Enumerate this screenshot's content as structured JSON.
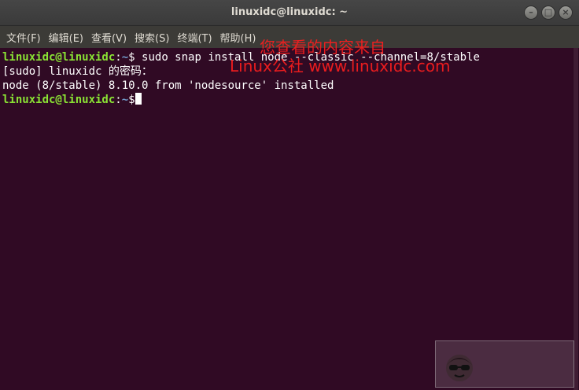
{
  "window": {
    "title": "linuxidc@linuxidc: ~",
    "controls": [
      "–",
      "□",
      "×"
    ]
  },
  "menubar": {
    "items": [
      "文件(F)",
      "编辑(E)",
      "查看(V)",
      "搜索(S)",
      "终端(T)",
      "帮助(H)"
    ]
  },
  "terminal": {
    "lines": [
      {
        "user": "linuxidc@linuxidc",
        "sep": ":",
        "path": "~",
        "prompt": "$ ",
        "text": "sudo snap install node --classic --channel=8/stable"
      },
      {
        "text": "[sudo] linuxidc 的密码："
      },
      {
        "text": "node (8/stable) 8.10.0 from 'nodesource' installed"
      },
      {
        "user": "linuxidc@linuxidc",
        "sep": ":",
        "path": "~",
        "prompt": "$",
        "text": ""
      }
    ]
  },
  "watermark": {
    "line1": "您查看的内容来自",
    "line2": "Linux公社 www.linuxidc.com"
  },
  "colors": {
    "terminal_bg": "#300a24",
    "user_green": "#8ae234",
    "path_blue": "#729fcf",
    "watermark_red": "#ff1e1e"
  }
}
